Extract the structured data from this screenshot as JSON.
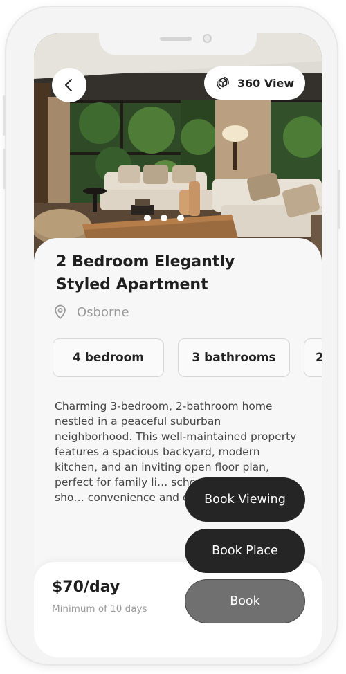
{
  "header": {
    "view_label": "360 View",
    "back_icon": "chevron-left-icon",
    "view_icon": "cube-360-icon"
  },
  "gallery": {
    "slide_count": 3,
    "indicator_color": "#ffffff"
  },
  "listing": {
    "title": "2 Bedroom Elegantly Styled Apartment",
    "location": "Osborne",
    "location_icon": "map-pin-icon",
    "features": [
      "4 bedroom",
      "3 bathrooms",
      "2"
    ],
    "description": "Charming 3-bedroom, 2-bathroom home nestled in a peaceful suburban neighborhood. This well-maintained property features a spacious backyard, modern kitchen, and an inviting open floor plan, perfect for family li… schools, parks, and sho… convenience and comfor… location."
  },
  "pricing": {
    "price": "$70/day",
    "minimum": "Minimum of 10 days"
  },
  "actions": {
    "book_viewing": "Book Viewing",
    "book_place": "Book Place",
    "book": "Book"
  },
  "colors": {
    "dark_button": "#252525",
    "muted_button": "#707070",
    "card_background": "#f7f7f7",
    "text_primary": "#1f1f1f",
    "text_muted": "#9a9a9a"
  }
}
